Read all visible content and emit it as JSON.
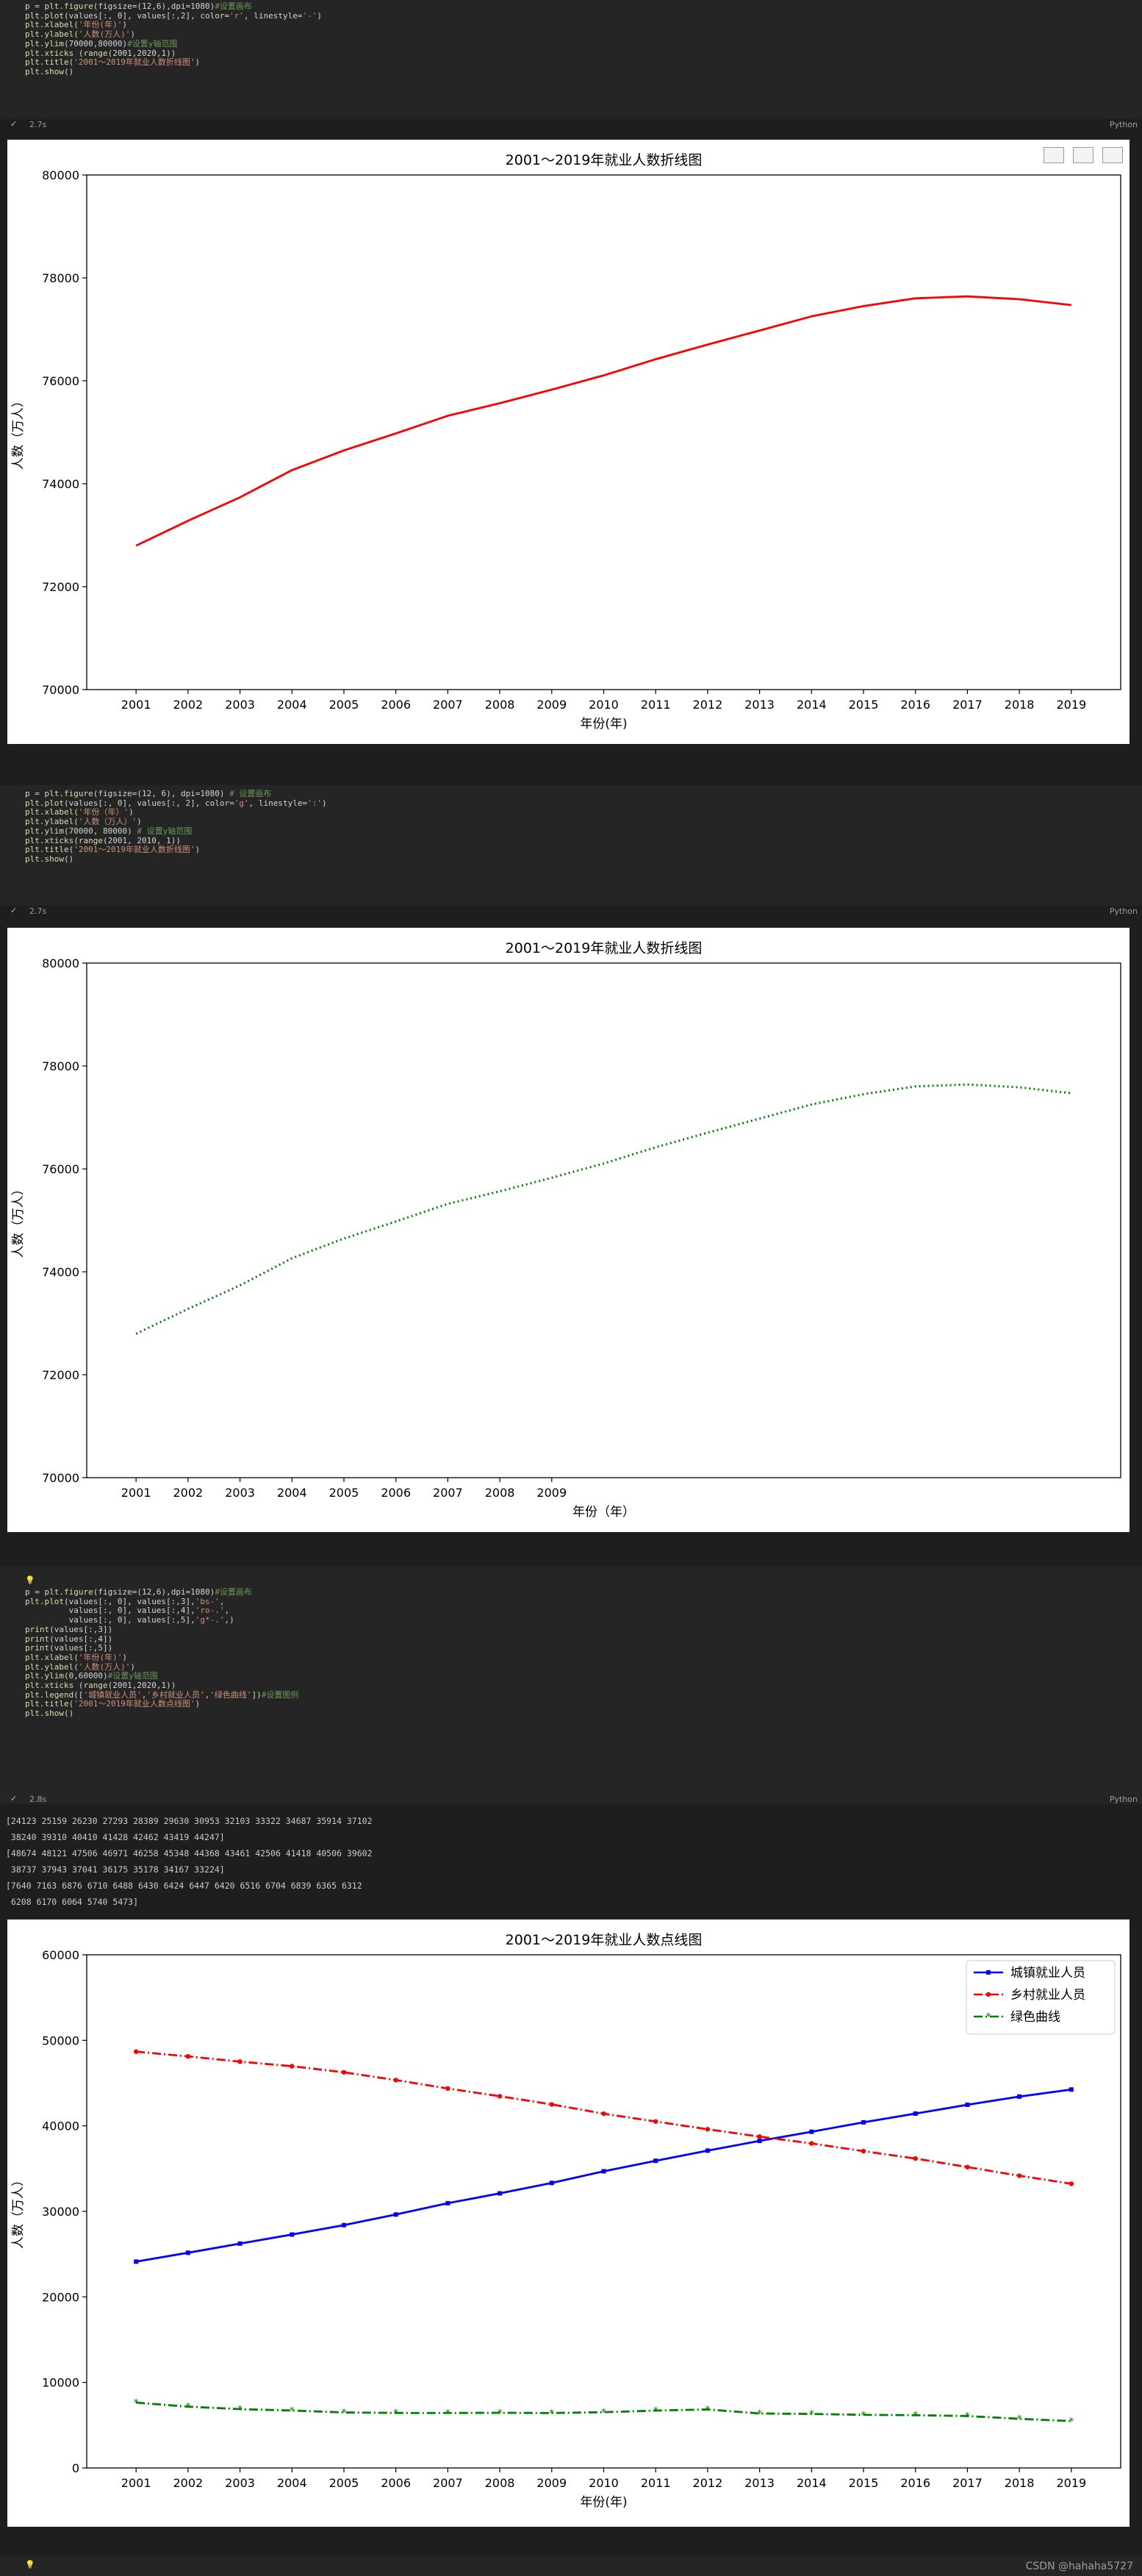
{
  "cells": [
    {
      "code": [
        "p = plt.figure(figsize=(12,6),dpi=1080)#设置画布",
        "plt.plot(values[:, 0], values[:,2], color='r', linestyle='-')",
        "plt.xlabel('年份(年)')",
        "plt.ylabel('人数(万人)')",
        "plt.ylim(70000,80000)#设置y轴范围",
        "plt.xticks (range(2001,2020,1))",
        "plt.title('2001～2019年就业人数折线图')",
        "plt.show()"
      ],
      "time": "2.7s",
      "lang": "Python"
    },
    {
      "code": [
        "p = plt.figure(figsize=(12, 6), dpi=1080) # 设置画布",
        "plt.plot(values[:, 0], values[:, 2], color='g', linestyle=':')",
        "plt.xlabel('年份（年）')",
        "plt.ylabel('人数（万人）')",
        "plt.ylim(70000, 80000) # 设置y轴范围",
        "plt.xticks(range(2001, 2010, 1))",
        "plt.title('2001～2019年就业人数折线图')",
        "plt.show()"
      ],
      "time": "2.7s",
      "lang": "Python"
    },
    {
      "hint": "💡",
      "code": [
        "p = plt.figure(figsize=(12,6),dpi=1080)#设置画布",
        "plt.plot(values[:, 0], values[:,3],'bs-',",
        "         values[:, 0], values[:,4],'ro-.',",
        "         values[:, 0], values[:,5],'g*-.',)",
        "print(values[:,3])",
        "print(values[:,4])",
        "print(values[:,5])",
        "plt.xlabel('年份(年)')",
        "plt.ylabel('人数(万人)')",
        "plt.ylim(0,60000)#设置y轴范围",
        "plt.xticks (range(2001,2020,1))",
        "plt.legend(['城镇就业人员','乡村就业人员','绿色曲线'])#设置图例",
        "plt.title('2001～2019年就业人数点线图')",
        "plt.show()"
      ],
      "time": "2.8s",
      "lang": "Python",
      "stdout": [
        "[24123 25159 26230 27293 28389 29630 30953 32103 33322 34687 35914 37102",
        " 38240 39310 40410 41428 42462 43419 44247]",
        "[48674 48121 47506 46971 46258 45348 44368 43461 42506 41418 40506 39602",
        " 38737 37943 37041 36175 35178 34167 33224]",
        "[7640 7163 6876 6710 6488 6430 6424 6447 6420 6516 6704 6839 6365 6312",
        " 6208 6170 6064 5740 5473]"
      ]
    }
  ],
  "chart_data": [
    {
      "type": "line",
      "title": "2001～2019年就业人数折线图",
      "xlabel": "年份(年)",
      "ylabel": "人数（万人）",
      "ylim": [
        70000,
        80000
      ],
      "yticks": [
        70000,
        72000,
        74000,
        76000,
        78000,
        80000
      ],
      "xticks": [
        2001,
        2002,
        2003,
        2004,
        2005,
        2006,
        2007,
        2008,
        2009,
        2010,
        2011,
        2012,
        2013,
        2014,
        2015,
        2016,
        2017,
        2018,
        2019
      ],
      "x": [
        2001,
        2002,
        2003,
        2004,
        2005,
        2006,
        2007,
        2008,
        2009,
        2010,
        2011,
        2012,
        2013,
        2014,
        2015,
        2016,
        2017,
        2018,
        2019
      ],
      "series": [
        {
          "values": [
            72797,
            73280,
            73736,
            74264,
            74647,
            74978,
            75321,
            75564,
            75828,
            76105,
            76420,
            76704,
            76977,
            77253,
            77451,
            77603,
            77640,
            77586,
            77471
          ],
          "color": "#ff0000",
          "style": "solid"
        }
      ],
      "grid": false
    },
    {
      "type": "line",
      "title": "2001～2019年就业人数折线图",
      "xlabel": "年份（年）",
      "ylabel": "人数（万人）",
      "ylim": [
        70000,
        80000
      ],
      "yticks": [
        70000,
        72000,
        74000,
        76000,
        78000,
        80000
      ],
      "xticks": [
        2001,
        2002,
        2003,
        2004,
        2005,
        2006,
        2007,
        2008,
        2009
      ],
      "x": [
        2001,
        2002,
        2003,
        2004,
        2005,
        2006,
        2007,
        2008,
        2009,
        2010,
        2011,
        2012,
        2013,
        2014,
        2015,
        2016,
        2017,
        2018,
        2019
      ],
      "series": [
        {
          "values": [
            72797,
            73280,
            73736,
            74264,
            74647,
            74978,
            75321,
            75564,
            75828,
            76105,
            76420,
            76704,
            76977,
            77253,
            77451,
            77603,
            77640,
            77586,
            77471
          ],
          "color": "#008000",
          "style": "dotted"
        }
      ],
      "grid": false
    },
    {
      "type": "line",
      "title": "2001～2019年就业人数点线图",
      "xlabel": "年份(年)",
      "ylabel": "人数（万人）",
      "ylim": [
        0,
        60000
      ],
      "yticks": [
        0,
        10000,
        20000,
        30000,
        40000,
        50000,
        60000
      ],
      "xticks": [
        2001,
        2002,
        2003,
        2004,
        2005,
        2006,
        2007,
        2008,
        2009,
        2010,
        2011,
        2012,
        2013,
        2014,
        2015,
        2016,
        2017,
        2018,
        2019
      ],
      "x": [
        2001,
        2002,
        2003,
        2004,
        2005,
        2006,
        2007,
        2008,
        2009,
        2010,
        2011,
        2012,
        2013,
        2014,
        2015,
        2016,
        2017,
        2018,
        2019
      ],
      "legend_position": "top-right",
      "series": [
        {
          "name": "城镇就业人员",
          "values": [
            24123,
            25159,
            26230,
            27293,
            28389,
            29630,
            30953,
            32103,
            33322,
            34687,
            35914,
            37102,
            38240,
            39310,
            40410,
            41428,
            42462,
            43419,
            44247
          ],
          "color": "#0000ff",
          "style": "solid",
          "marker": "square"
        },
        {
          "name": "乡村就业人员",
          "values": [
            48674,
            48121,
            47506,
            46971,
            46258,
            45348,
            44368,
            43461,
            42506,
            41418,
            40506,
            39602,
            38737,
            37943,
            37041,
            36175,
            35178,
            34167,
            33224
          ],
          "color": "#ff0000",
          "style": "dashdot",
          "marker": "circle"
        },
        {
          "name": "绿色曲线",
          "values": [
            7640,
            7163,
            6876,
            6710,
            6488,
            6430,
            6424,
            6447,
            6420,
            6516,
            6704,
            6839,
            6365,
            6312,
            6208,
            6170,
            6064,
            5740,
            5473
          ],
          "color": "#008000",
          "style": "dashdot",
          "marker": "star"
        }
      ],
      "grid": false
    }
  ],
  "footer": {
    "watermark": "CSDN @hahaha5727"
  }
}
